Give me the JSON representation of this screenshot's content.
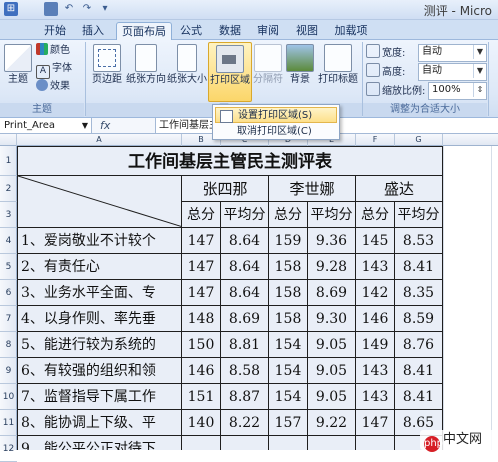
{
  "window": {
    "title": "测评 - Micro"
  },
  "tabs": [
    "开始",
    "插入",
    "页面布局",
    "公式",
    "数据",
    "审阅",
    "视图",
    "加载项"
  ],
  "active_tab": "页面布局",
  "ribbon": {
    "theme_group": {
      "theme_btn": "主题",
      "colors": "颜色",
      "fonts": "字体",
      "effects": "效果",
      "label": "主题"
    },
    "page_setup": {
      "margins": "页边距",
      "orientation": "纸张方向",
      "size": "纸张大小",
      "print_area": "打印区域",
      "breaks": "分隔符",
      "background": "背景",
      "print_titles": "打印标题",
      "label": "页"
    },
    "scale_group": {
      "width_label": "宽度:",
      "width_value": "自动",
      "height_label": "高度:",
      "height_value": "自动",
      "scale_label": "缩放比例:",
      "scale_value": "100%",
      "label": "调整为合适大小"
    }
  },
  "dropdown": {
    "items": [
      "设置打印区域(S)",
      "取消打印区域(C)"
    ]
  },
  "namebar": {
    "name_box": "Print_Area",
    "fx": "fx",
    "formula": "工作间基层主"
  },
  "columns": [
    "A",
    "B",
    "C",
    "D",
    "E",
    "F",
    "G"
  ],
  "rows": [
    "1",
    "2",
    "3",
    "4",
    "5",
    "6",
    "7",
    "8",
    "9",
    "10",
    "11",
    "12"
  ],
  "sheet": {
    "title": "工作间基层主管民主测评表",
    "people": [
      "张四那",
      "李世娜",
      "盛达"
    ],
    "sub_headers": [
      "总分",
      "平均分",
      "总分",
      "平均分",
      "总分",
      "平均分"
    ],
    "items": [
      {
        "label": "1、爱岗敬业不计较个",
        "values": [
          "147",
          "8.64",
          "159",
          "9.36",
          "145",
          "8.53"
        ]
      },
      {
        "label": "2、有责任心",
        "values": [
          "147",
          "8.64",
          "158",
          "9.28",
          "143",
          "8.41"
        ]
      },
      {
        "label": "3、业务水平全面、专",
        "values": [
          "147",
          "8.64",
          "158",
          "8.69",
          "142",
          "8.35"
        ]
      },
      {
        "label": "4、以身作则、率先垂",
        "values": [
          "148",
          "8.69",
          "158",
          "9.30",
          "146",
          "8.59"
        ]
      },
      {
        "label": "5、能进行较为系统的",
        "values": [
          "150",
          "8.81",
          "154",
          "9.05",
          "149",
          "8.76"
        ]
      },
      {
        "label": "6、有较强的组织和领",
        "values": [
          "146",
          "8.58",
          "154",
          "9.05",
          "143",
          "8.41"
        ]
      },
      {
        "label": "7、监督指导下属工作",
        "values": [
          "151",
          "8.87",
          "154",
          "9.05",
          "143",
          "8.41"
        ]
      },
      {
        "label": "8、能协调上下级、平",
        "values": [
          "140",
          "8.22",
          "157",
          "9.22",
          "147",
          "8.65"
        ]
      },
      {
        "label": "9、能公平公正对待下",
        "values": [
          "",
          "",
          "",
          "",
          "",
          ""
        ]
      }
    ]
  },
  "watermark": {
    "text": "中文网",
    "logo": "php"
  },
  "colors": {
    "accent": "#f7c64b",
    "tab_bg": "#cfdff3"
  }
}
